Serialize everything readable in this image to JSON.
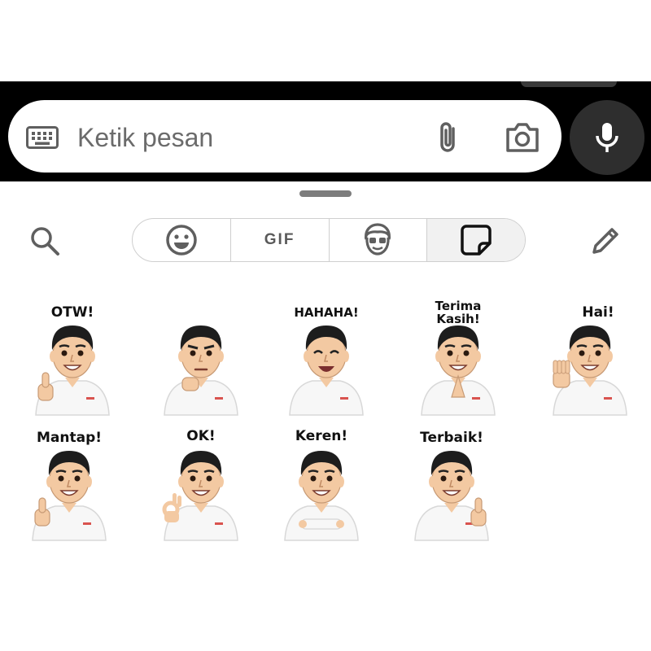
{
  "composer": {
    "placeholder": "Ketik pesan",
    "icons": [
      "keyboard-icon",
      "attach-icon",
      "camera-icon",
      "mic-icon"
    ]
  },
  "toolbar": {
    "search_icon": "search-icon",
    "edit_icon": "pencil-icon",
    "tabs": [
      {
        "name": "emoji",
        "icon": "smiley-icon",
        "label": ""
      },
      {
        "name": "gif",
        "icon": "",
        "label": "GIF"
      },
      {
        "name": "avatar",
        "icon": "avatar-icon",
        "label": ""
      },
      {
        "name": "stickers",
        "icon": "sticker-icon",
        "label": "",
        "active": true
      }
    ]
  },
  "stickers": [
    {
      "caption": "OTW!",
      "gesture": "thumbs-up"
    },
    {
      "caption": "",
      "gesture": "fist-on-chin"
    },
    {
      "caption": "HAHAHA!",
      "gesture": "laughing"
    },
    {
      "caption": "Terima Kasih!",
      "gesture": "namaste"
    },
    {
      "caption": "Hai!",
      "gesture": "wave"
    },
    {
      "caption": "Mantap!",
      "gesture": "thumbs-up"
    },
    {
      "caption": "OK!",
      "gesture": "ok-hand"
    },
    {
      "caption": "Keren!",
      "gesture": "arms-crossed"
    },
    {
      "caption": "Terbaik!",
      "gesture": "thumbs-up-right"
    }
  ],
  "colors": {
    "bar_background": "#000000",
    "mic_button": "#2e2e2e",
    "icon_gray": "#5f5f5f",
    "skin": "#f3c9a2",
    "hair": "#1d1d1d",
    "shirt": "#f7f7f7",
    "badge": "#d9534f"
  }
}
